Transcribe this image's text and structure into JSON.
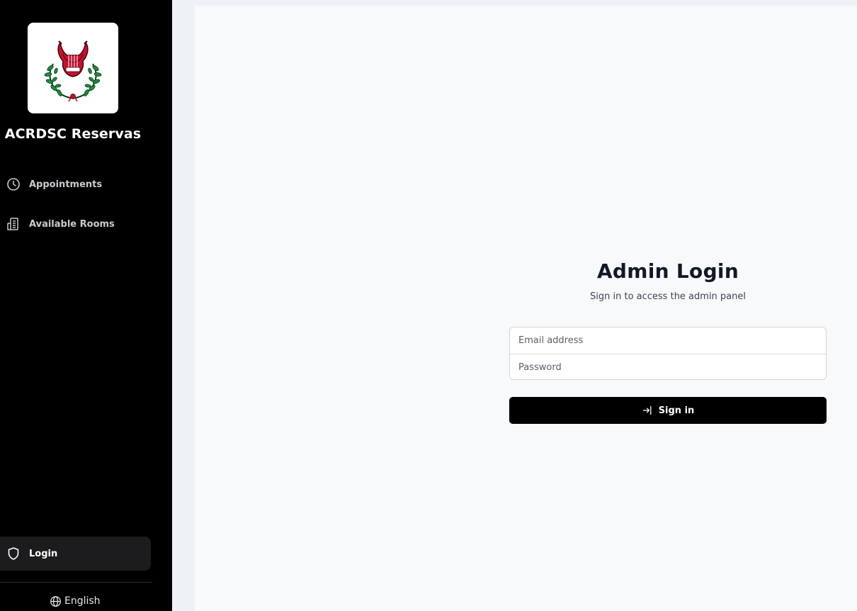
{
  "sidebar": {
    "app_title": "ACRDSC Reservas",
    "logo_icon": "lyre-laurel-emblem-icon",
    "nav": [
      {
        "label": "Appointments",
        "icon": "clock-icon"
      },
      {
        "label": "Available Rooms",
        "icon": "building-icon"
      }
    ],
    "login": {
      "label": "Login",
      "icon": "shield-icon"
    },
    "language": {
      "label": "English",
      "icon": "globe-icon"
    }
  },
  "login_form": {
    "heading": "Admin Login",
    "subheading": "Sign in to access the admin panel",
    "email_placeholder": "Email address",
    "email_value": "",
    "password_placeholder": "Password",
    "password_value": "",
    "submit_label": "Sign in",
    "submit_icon": "sign-in-arrow-icon"
  },
  "colors": {
    "sidebar_bg": "#000000",
    "main_bg": "#f8f9fb",
    "page_bg": "#eef1f6",
    "primary_button": "#000000",
    "logo_red": "#c8102e",
    "logo_green": "#1f8a3b"
  }
}
